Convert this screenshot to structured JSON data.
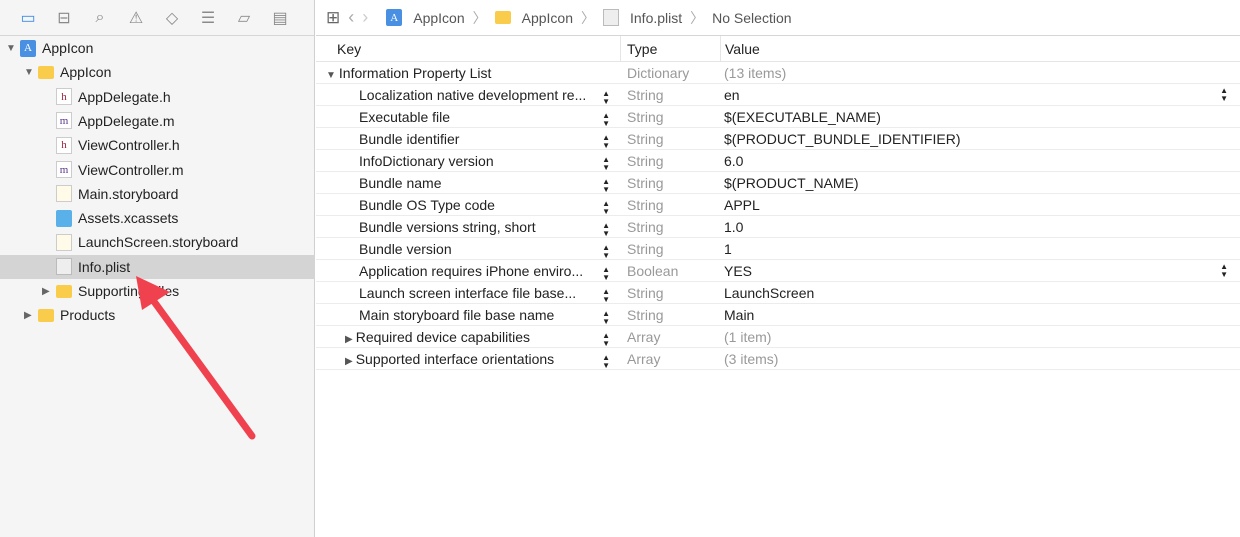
{
  "navigator": {
    "tabs": [
      "folder-icon",
      "hierarchy-icon",
      "search-icon",
      "warning-icon",
      "test-icon",
      "debug-icon",
      "breakpoint-icon",
      "report-icon"
    ],
    "tree": [
      {
        "label": "AppIcon",
        "type": "project",
        "depth": 0,
        "disclosure": "open"
      },
      {
        "label": "AppIcon",
        "type": "folder",
        "depth": 1,
        "disclosure": "open"
      },
      {
        "label": "AppDelegate.h",
        "type": "h",
        "glyph": "h",
        "depth": 2
      },
      {
        "label": "AppDelegate.m",
        "type": "m",
        "glyph": "m",
        "depth": 2
      },
      {
        "label": "ViewController.h",
        "type": "h",
        "glyph": "h",
        "depth": 2
      },
      {
        "label": "ViewController.m",
        "type": "m",
        "glyph": "m",
        "depth": 2
      },
      {
        "label": "Main.storyboard",
        "type": "storyboard",
        "depth": 2
      },
      {
        "label": "Assets.xcassets",
        "type": "xcassets",
        "depth": 2
      },
      {
        "label": "LaunchScreen.storyboard",
        "type": "storyboard",
        "depth": 2
      },
      {
        "label": "Info.plist",
        "type": "plist",
        "depth": 2,
        "selected": true
      },
      {
        "label": "Supporting Files",
        "type": "folder",
        "depth": 2,
        "disclosure": "closed"
      },
      {
        "label": "Products",
        "type": "folder",
        "depth": 1,
        "disclosure": "closed"
      }
    ]
  },
  "jumpbar": {
    "crumbs": [
      "AppIcon",
      "AppIcon",
      "Info.plist",
      "No Selection"
    ]
  },
  "plist": {
    "headers": {
      "key": "Key",
      "type": "Type",
      "value": "Value"
    },
    "rows": [
      {
        "key": "Information Property List",
        "type": "Dictionary",
        "value": "(13 items)",
        "root": true,
        "muted": true
      },
      {
        "key": "Localization native development re...",
        "type": "String",
        "value": "en",
        "popup": true
      },
      {
        "key": "Executable file",
        "type": "String",
        "value": "$(EXECUTABLE_NAME)"
      },
      {
        "key": "Bundle identifier",
        "type": "String",
        "value": "$(PRODUCT_BUNDLE_IDENTIFIER)"
      },
      {
        "key": "InfoDictionary version",
        "type": "String",
        "value": "6.0"
      },
      {
        "key": "Bundle name",
        "type": "String",
        "value": "$(PRODUCT_NAME)"
      },
      {
        "key": "Bundle OS Type code",
        "type": "String",
        "value": "APPL"
      },
      {
        "key": "Bundle versions string, short",
        "type": "String",
        "value": "1.0"
      },
      {
        "key": "Bundle version",
        "type": "String",
        "value": "1"
      },
      {
        "key": "Application requires iPhone enviro...",
        "type": "Boolean",
        "value": "YES",
        "popup": true
      },
      {
        "key": "Launch screen interface file base...",
        "type": "String",
        "value": "LaunchScreen"
      },
      {
        "key": "Main storyboard file base name",
        "type": "String",
        "value": "Main"
      },
      {
        "key": "Required device capabilities",
        "type": "Array",
        "value": "(1 item)",
        "expandable": true,
        "muted": true
      },
      {
        "key": "Supported interface orientations",
        "type": "Array",
        "value": "(3 items)",
        "expandable": true,
        "muted": true
      }
    ]
  },
  "annotation": {
    "color": "#f0414f"
  }
}
